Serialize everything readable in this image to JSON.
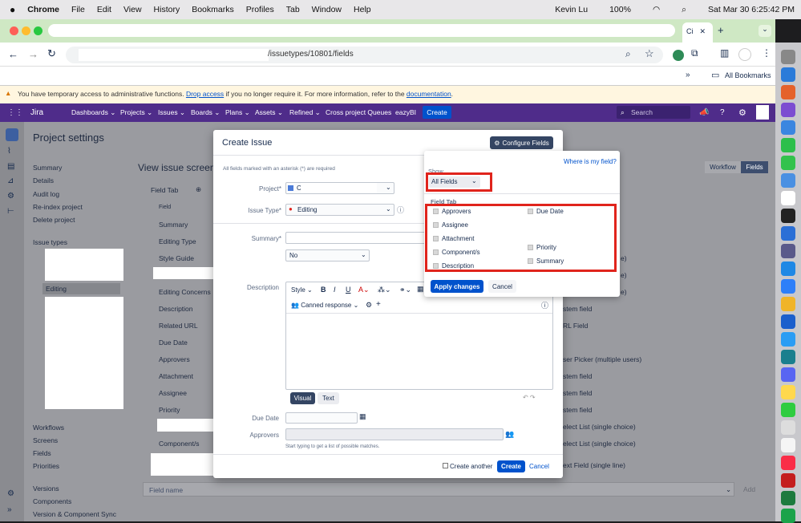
{
  "mac_menu": {
    "app": "Chrome",
    "items": [
      "File",
      "Edit",
      "View",
      "History",
      "Bookmarks",
      "Profiles",
      "Tab",
      "Window",
      "Help"
    ],
    "user": "Kevin Lu",
    "battery": "100%",
    "datetime": "Sat Mar 30  6:25:42 PM"
  },
  "browser": {
    "tab_title": "Ci",
    "url": "/issuetypes/10801/fields",
    "bookmarks_label": "All Bookmarks"
  },
  "banner": {
    "text_before": "You have temporary access to administrative functions. ",
    "link1": "Drop access",
    "text_mid": " if you no longer require it. For more information, refer to the ",
    "link2": "documentation",
    "text_end": "."
  },
  "jira_nav": {
    "logo": "Jira",
    "items": [
      "Dashboards ⌄",
      "Projects ⌄",
      "Issues ⌄",
      "Boards ⌄",
      "Plans ⌄",
      "Assets ⌄",
      "Refined ⌄",
      "Cross project Queues",
      "eazyBI"
    ],
    "create": "Create",
    "search_placeholder": "Search"
  },
  "sidebar": {
    "title": "Project settings",
    "items": [
      "Summary",
      "Details",
      "Audit log",
      "Re-index project",
      "Delete project"
    ],
    "issue_types_label": "Issue types",
    "selected_type": "Editing",
    "bottom_items": [
      "Workflows",
      "Screens",
      "Fields",
      "Priorities",
      "Versions",
      "Components",
      "Version & Component Sync"
    ]
  },
  "main": {
    "heading": "View issue screen",
    "tab": "Field Tab",
    "field_header": "Field",
    "fields": [
      "Summary",
      "Editing Type",
      "Style Guide",
      "Editing Concerns",
      "Description",
      "Related URL",
      "Due Date",
      "Approvers",
      "Attachment",
      "Assignee",
      "Priority",
      "Component/s"
    ],
    "types": [
      "e)",
      "e)",
      "e)",
      "stem field",
      "RL Field",
      "ser Picker (multiple users)",
      "stem field",
      "stem field",
      "stem field",
      "elect List (single choice)",
      "elect List (single choice)",
      "ext Field (single line)"
    ],
    "workflow_btn": "Workflow",
    "fields_btn": "Fields",
    "field_name_placeholder": "Field name",
    "add_btn": "Add"
  },
  "modal": {
    "title": "Create Issue",
    "configure": "Configure Fields",
    "required_note": "All fields marked with an asterisk (*) are required",
    "project_label": "Project*",
    "project_value": "C",
    "issuetype_label": "Issue Type*",
    "issuetype_value": "Editing",
    "summary_label": "Summary*",
    "no_value": "No",
    "description_label": "Description",
    "style": "Style",
    "canned": "Canned response",
    "visual": "Visual",
    "text": "Text",
    "duedate_label": "Due Date",
    "approvers_label": "Approvers",
    "approvers_hint": "Start typing to get a list of possible matches.",
    "create_another": "Create another",
    "create": "Create",
    "cancel": "Cancel"
  },
  "popover": {
    "where": "Where is my field?",
    "show": "Show",
    "show_value": "All Fields",
    "tab_label": "Field Tab",
    "left": [
      "Approvers",
      "Assignee",
      "Attachment",
      "Component/s",
      "Description"
    ],
    "right": [
      "Due Date",
      "Priority",
      "Summary"
    ],
    "apply": "Apply changes",
    "cancel": "Cancel"
  },
  "colors": {
    "jira_nav": "#4f2c8a",
    "primary": "#0052cc",
    "highlight": "#e0241c"
  }
}
